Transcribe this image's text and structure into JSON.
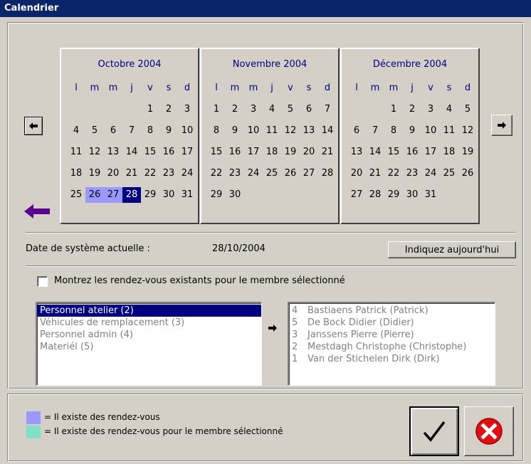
{
  "window": {
    "title": "Calendrier"
  },
  "colors": {
    "appointments": "#9999ff",
    "member_appointments": "#80e0c8",
    "today": "#000080",
    "title_bar": "#0a246a",
    "nav_arrow": "#5a0090"
  },
  "nav": {
    "prev_icon": "left-arrow-icon",
    "next_icon": "right-arrow-icon",
    "back_icon": "purple-back-arrow-icon"
  },
  "calendar": {
    "weekdays": [
      "l",
      "m",
      "m",
      "j",
      "v",
      "s",
      "d"
    ],
    "months": [
      {
        "title": "Octobre 2004",
        "weeks": [
          [
            "",
            "",
            "",
            "",
            "1",
            "2",
            "3"
          ],
          [
            "4",
            "5",
            "6",
            "7",
            "8",
            "9",
            "10"
          ],
          [
            "11",
            "12",
            "13",
            "14",
            "15",
            "16",
            "17"
          ],
          [
            "18",
            "19",
            "20",
            "21",
            "22",
            "23",
            "24"
          ],
          [
            "25",
            "26",
            "27",
            "28",
            "29",
            "30",
            "31"
          ]
        ],
        "appointment_days": [
          "26",
          "27"
        ],
        "today": "28"
      },
      {
        "title": "Novembre 2004",
        "weeks": [
          [
            "1",
            "2",
            "3",
            "4",
            "5",
            "6",
            "7"
          ],
          [
            "8",
            "9",
            "10",
            "11",
            "12",
            "13",
            "14"
          ],
          [
            "15",
            "16",
            "17",
            "18",
            "19",
            "20",
            "21"
          ],
          [
            "22",
            "23",
            "24",
            "25",
            "26",
            "27",
            "28"
          ],
          [
            "29",
            "30",
            "",
            "",
            "",
            "",
            ""
          ]
        ],
        "appointment_days": [],
        "today": ""
      },
      {
        "title": "Décembre 2004",
        "weeks": [
          [
            "",
            "",
            "1",
            "2",
            "3",
            "4",
            "5"
          ],
          [
            "6",
            "7",
            "8",
            "9",
            "10",
            "11",
            "12"
          ],
          [
            "13",
            "14",
            "15",
            "16",
            "17",
            "18",
            "19"
          ],
          [
            "20",
            "21",
            "22",
            "23",
            "24",
            "25",
            "26"
          ],
          [
            "27",
            "28",
            "29",
            "30",
            "31",
            "",
            ""
          ]
        ],
        "appointment_days": [],
        "today": ""
      }
    ]
  },
  "system_date": {
    "label": "Date de système actuelle :",
    "value": "28/10/2004",
    "today_button": "Indiquez aujourd'hui"
  },
  "show_member_checkbox": {
    "label": "Montrez les rendez-vous existants pour le membre sélectionné",
    "checked": false
  },
  "groups": [
    {
      "label": "Personnel atelier (2)",
      "selected": true
    },
    {
      "label": "Véhicules de remplacement (3)",
      "selected": false
    },
    {
      "label": "Personnel admin (4)",
      "selected": false
    },
    {
      "label": "Materiél (5)",
      "selected": false
    }
  ],
  "transfer_icon": "right-arrow-icon",
  "members": [
    {
      "num": "4",
      "name": "Bastiaens Patrick (Patrick)"
    },
    {
      "num": "5",
      "name": "De Bock Didier (Didier)"
    },
    {
      "num": "3",
      "name": "Janssens Pierre (Pierre)"
    },
    {
      "num": "2",
      "name": "Mestdagh Christophe (Christophe)"
    },
    {
      "num": "1",
      "name": "Van der Stichelen Dirk (Dirk)"
    }
  ],
  "legend": {
    "appointments": "= Il existe des rendez-vous",
    "member_appointments": "= Il existe des rendez-vous pour le membre sélectionné"
  },
  "footer": {
    "ok_icon": "checkmark-icon",
    "cancel_icon": "cancel-x-icon"
  }
}
